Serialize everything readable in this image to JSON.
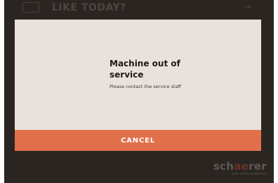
{
  "background": {
    "title": "LIKE TODAY?",
    "back_icon": "back-icon",
    "next_icon": "arrow-right-icon",
    "next_glyph": "→"
  },
  "dialog": {
    "title": "Machine out of service",
    "message": "Please contact the service staff",
    "cancel_label": "CANCEL"
  },
  "brand": {
    "logo_text": "schaerer",
    "logo_prefix": "sch",
    "logo_accent": "ae",
    "logo_suffix": "rer",
    "tagline": "swiss coffee competence"
  },
  "colors": {
    "screen_bg": "#2b2522",
    "dialog_bg": "#e9e2dc",
    "accent": "#e0704a"
  }
}
